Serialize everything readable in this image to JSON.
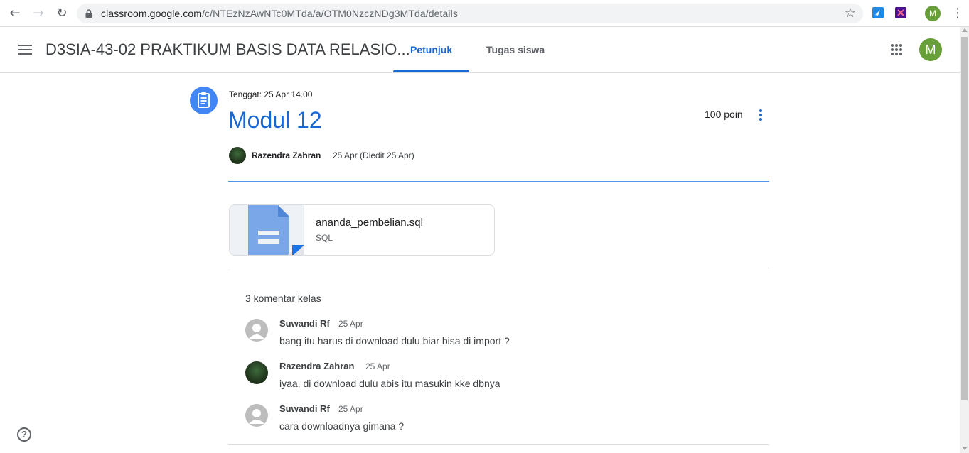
{
  "browser": {
    "url_host": "classroom.google.com",
    "url_path": "/c/NTEzNzAwNTc0MTda/a/OTM0NzczNDg3MTda/details",
    "profile_initial": "M",
    "icons": [
      "back-icon",
      "forward-icon",
      "reload-icon",
      "lock-icon",
      "bookmark-star-icon",
      "extension-icon",
      "extension-icon",
      "menu-kebab-icon"
    ]
  },
  "header": {
    "course_title": "D3SIA-43-02 PRAKTIKUM BASIS DATA RELASIO...",
    "tabs": [
      {
        "label": "Petunjuk",
        "active": true
      },
      {
        "label": "Tugas siswa",
        "active": false
      }
    ],
    "avatar_initial": "M"
  },
  "assignment": {
    "due": "Tenggat: 25 Apr 14.00",
    "title": "Modul 12",
    "points": "100 poin",
    "author": "Razendra Zahran",
    "posted": "25 Apr (Diedit 25 Apr)",
    "attachment": {
      "name": "ananda_pembelian.sql",
      "type": "SQL"
    }
  },
  "comments": {
    "count_label": "3 komentar kelas",
    "items": [
      {
        "name": "Suwandi Rf",
        "date": "25 Apr",
        "text": "bang itu harus di download dulu biar bisa di import ?",
        "avatar": "default"
      },
      {
        "name": "Razendra Zahran",
        "date": "25 Apr",
        "text": "iyaa, di download dulu abis itu masukin kke dbnya",
        "avatar": "photo"
      },
      {
        "name": "Suwandi Rf",
        "date": "25 Apr",
        "text": "cara downloadnya gimana ?",
        "avatar": "default"
      }
    ]
  },
  "colors": {
    "accent": "#1967d2",
    "icon_blue": "#4285f4",
    "profile_green": "#689f38"
  }
}
